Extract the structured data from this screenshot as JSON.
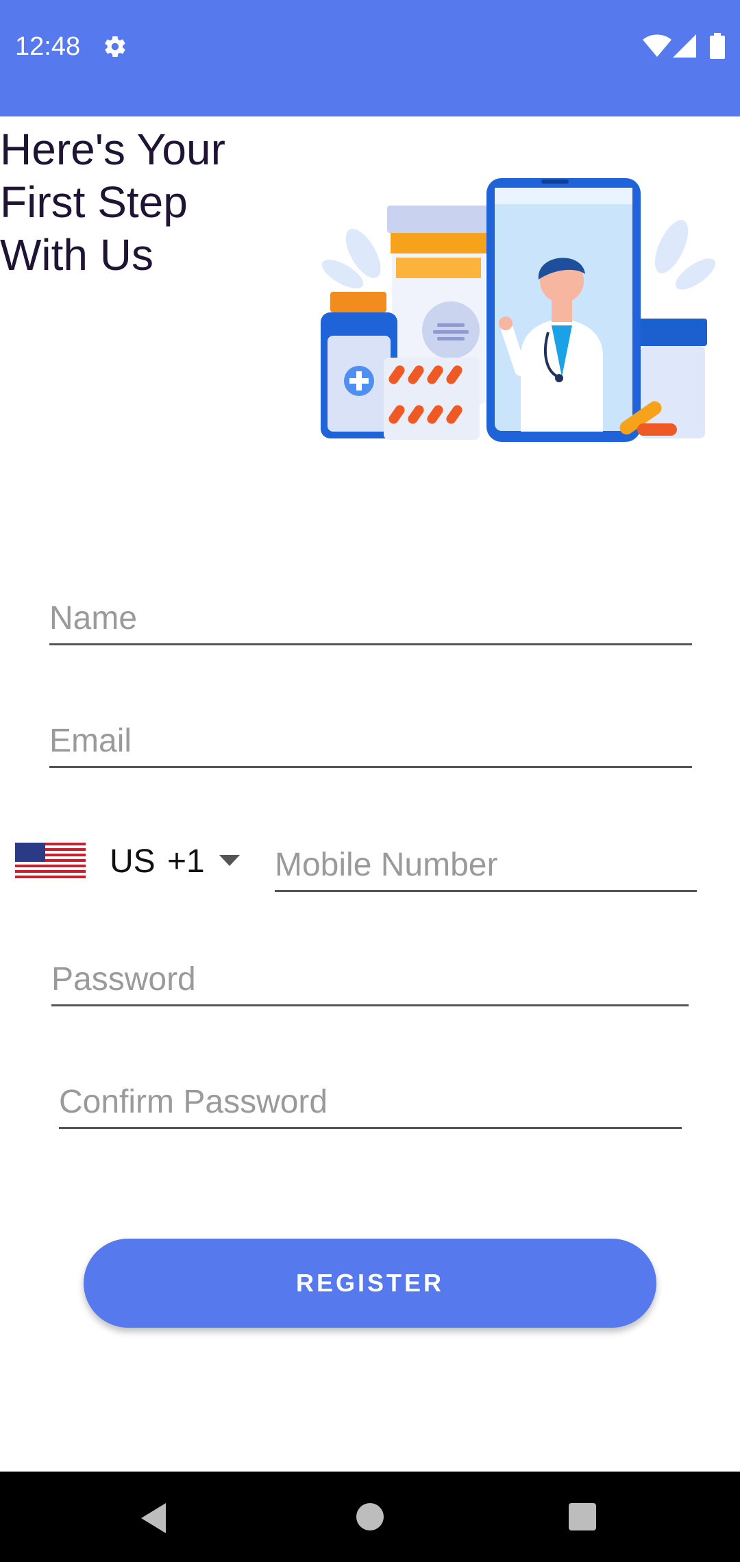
{
  "status_bar": {
    "time": "12:48",
    "background": "#5779ee"
  },
  "hero": {
    "headline": "Here's Your\nFirst Step\nWith Us"
  },
  "form": {
    "name_placeholder": "Name",
    "email_placeholder": "Email",
    "country": {
      "code": "US",
      "dial_code": "+1"
    },
    "mobile_placeholder": "Mobile Number",
    "password_placeholder": "Password",
    "confirm_password_placeholder": "Confirm Password"
  },
  "actions": {
    "register_label": "REGISTER"
  },
  "colors": {
    "accent": "#5779ee",
    "heading_text": "#1f1433",
    "placeholder": "#9a9a9a"
  },
  "icons": {
    "status": [
      "gear-icon",
      "wifi-icon",
      "signal-icon",
      "battery-icon"
    ],
    "nav": [
      "back-icon",
      "home-icon",
      "recents-icon"
    ],
    "country_flag": "us-flag-icon"
  }
}
